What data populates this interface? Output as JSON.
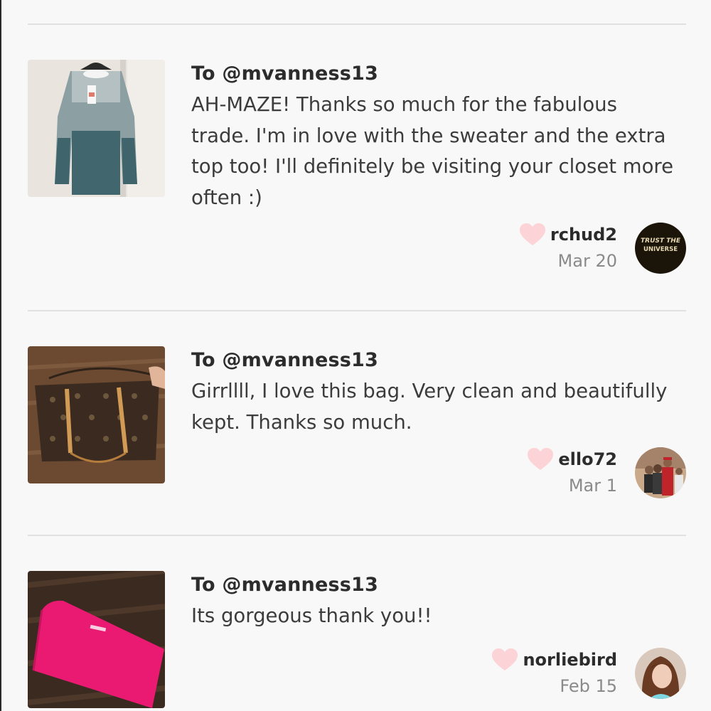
{
  "colors": {
    "heart": "#fcd3d6",
    "divider": "#e2e0e0",
    "background": "#f9f8f8"
  },
  "notes": [
    {
      "to": "To @mvanness13",
      "message": "AH-MAZE! Thanks so much for the fabulous trade. I'm in love with the sweater and the extra top too! I'll definitely be visiting your closet more often :)",
      "username": "rchud2",
      "date": "Mar 20",
      "item_image": "striped sweater on hanger",
      "avatar_text": [
        "TRUST THE",
        "UNIVERSE"
      ]
    },
    {
      "to": "To @mvanness13",
      "message": "Girrllll, I love this bag. Very clean and beautifully kept. Thanks so much.",
      "username": "ello72",
      "date": "Mar 1",
      "item_image": "monogram tote bag",
      "avatar_text": []
    },
    {
      "to": "To @mvanness13",
      "message": "Its gorgeous thank you!!",
      "username": "norliebird",
      "date": "Feb 15",
      "item_image": "pink wallet",
      "avatar_text": []
    }
  ]
}
